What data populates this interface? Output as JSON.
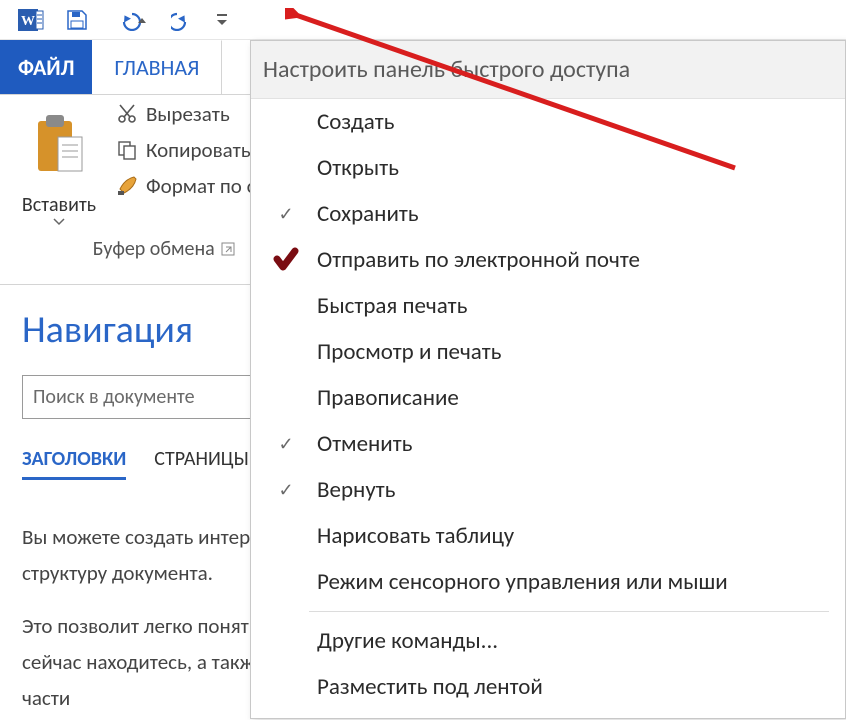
{
  "qat": {
    "word_icon": "word-app-icon",
    "save_icon": "save-icon",
    "undo_icon": "undo-icon",
    "redo_icon": "redo-icon",
    "more_icon": "customize-qat-icon"
  },
  "tabs": {
    "file": "ФАЙЛ",
    "home": "ГЛАВНАЯ"
  },
  "ribbon": {
    "paste_label": "Вставить",
    "cut_label": "Вырезать",
    "copy_label": "Копировать",
    "format_painter_label": "Формат по образцу",
    "group_footer": "Буфер обмена"
  },
  "nav": {
    "title": "Навигация",
    "search_placeholder": "Поиск в документе",
    "tab_headings": "ЗАГОЛОВКИ",
    "tab_pages": "СТРАНИЦЫ",
    "body_line1": "Вы можете создать интерактивную структуру документа.",
    "body_line2": "Это позволит легко понять, где вы",
    "body_line3": "сейчас находитесь, а также быстро",
    "body_line4": "части"
  },
  "menu": {
    "title": "Настроить панель быстрого доступа",
    "items": [
      {
        "label": "Создать",
        "checked": false
      },
      {
        "label": "Открыть",
        "checked": false
      },
      {
        "label": "Сохранить",
        "checked": true
      },
      {
        "label": "Отправить по электронной почте",
        "checked": false,
        "hover": true
      },
      {
        "label": "Быстрая печать",
        "checked": false
      },
      {
        "label": "Просмотр и печать",
        "checked": false
      },
      {
        "label": "Правописание",
        "checked": false
      },
      {
        "label": "Отменить",
        "checked": true
      },
      {
        "label": "Вернуть",
        "checked": true
      },
      {
        "label": "Нарисовать таблицу",
        "checked": false
      },
      {
        "label": "Режим сенсорного управления или мыши",
        "checked": false
      }
    ],
    "other_commands": "Другие команды...",
    "below_ribbon": "Разместить под лентой"
  }
}
